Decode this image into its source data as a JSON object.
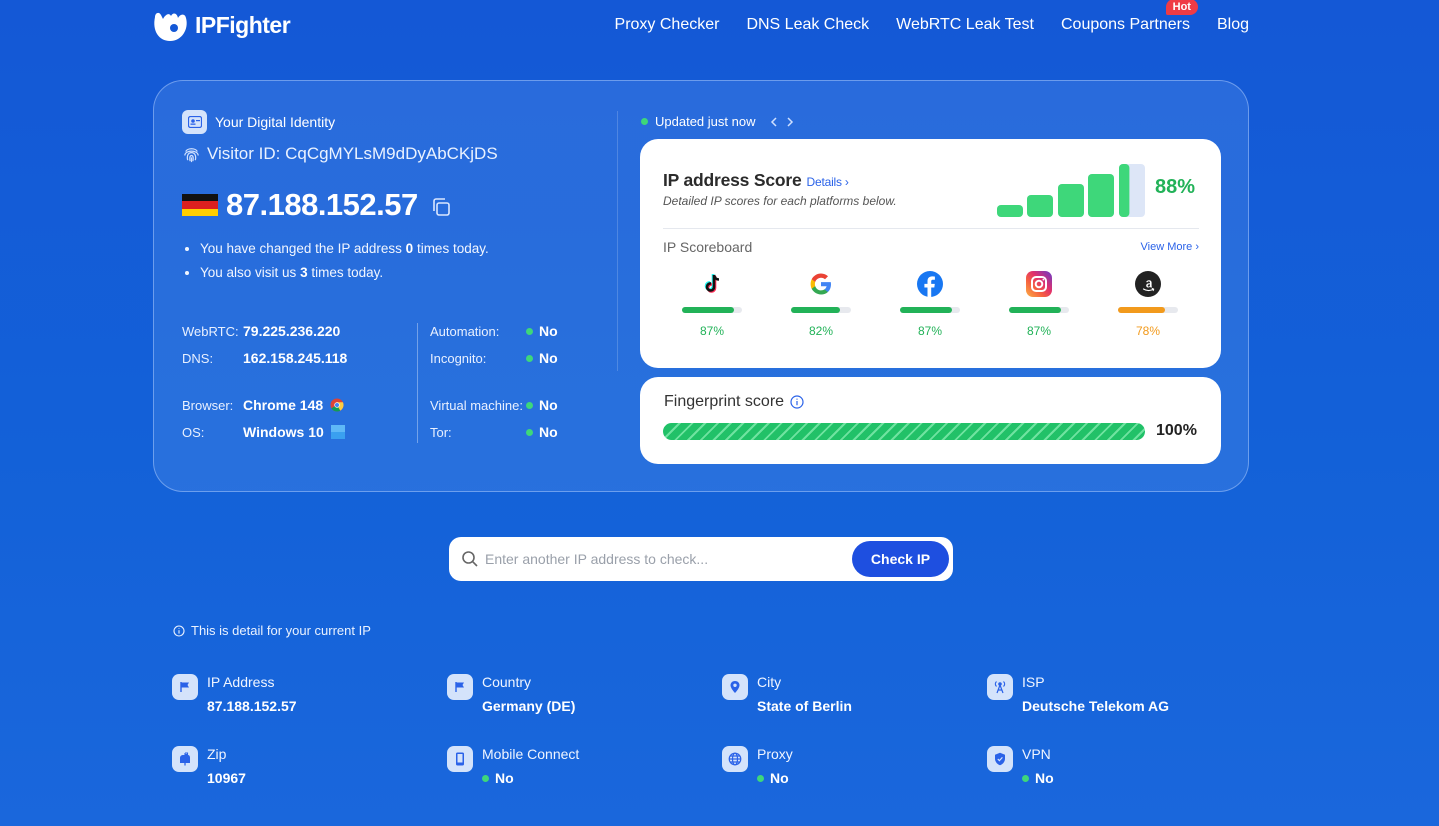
{
  "header": {
    "logo_text": "IPFighter",
    "nav": [
      {
        "label": "Proxy Checker"
      },
      {
        "label": "DNS Leak Check"
      },
      {
        "label": "WebRTC Leak Test"
      },
      {
        "label": "Coupons Partners",
        "badge": "Hot"
      },
      {
        "label": "Blog"
      }
    ]
  },
  "identity": {
    "title": "Your Digital Identity",
    "visitor_id": "Visitor ID: CqCgMYLsM9dDyAbCKjDS",
    "ip": "87.188.152.57",
    "bullets": {
      "b1_pre": "You have changed the IP address ",
      "b1_num": "0",
      "b1_post": " times today.",
      "b2_pre": "You also visit us ",
      "b2_num": "3",
      "b2_post": " times today."
    },
    "webrtc_label": "WebRTC:",
    "webrtc_value": "79.225.236.220",
    "dns_label": "DNS:",
    "dns_value": "162.158.245.118",
    "browser_label": "Browser:",
    "browser_value": "Chrome 148",
    "os_label": "OS:",
    "os_value": "Windows 10",
    "automation_label": "Automation:",
    "automation_value": "No",
    "incognito_label": "Incognito:",
    "incognito_value": "No",
    "vm_label": "Virtual machine:",
    "vm_value": "No",
    "tor_label": "Tor:",
    "tor_value": "No"
  },
  "score": {
    "updated": "Updated just now",
    "title": "IP address Score",
    "details_link": "Details ›",
    "subtitle": "Detailed IP scores for each platforms below.",
    "percent": "88%",
    "percent_value": 88,
    "scoreboard_title": "IP Scoreboard",
    "view_more": "View More ›",
    "platforms": [
      {
        "name": "tiktok-icon",
        "pct": "87%",
        "value": 87,
        "color": "#22b258"
      },
      {
        "name": "google-icon",
        "pct": "82%",
        "value": 82,
        "color": "#22b258"
      },
      {
        "name": "facebook-icon",
        "pct": "87%",
        "value": 87,
        "color": "#22b258"
      },
      {
        "name": "instagram-icon",
        "pct": "87%",
        "value": 87,
        "color": "#22b258"
      },
      {
        "name": "amazon-icon",
        "pct": "78%",
        "value": 78,
        "color": "#f29a1c"
      }
    ]
  },
  "fingerprint": {
    "title": "Fingerprint score",
    "percent": "100%",
    "value": 100
  },
  "search": {
    "placeholder": "Enter another IP address to check...",
    "button": "Check IP"
  },
  "details": {
    "note": "This is detail for your current IP",
    "items": [
      {
        "label": "IP Address",
        "value": "87.188.152.57",
        "icon": "flag-icon"
      },
      {
        "label": "Country",
        "value": "Germany (DE)",
        "icon": "flag-icon"
      },
      {
        "label": "City",
        "value": "State of Berlin",
        "icon": "location-pin-icon"
      },
      {
        "label": "ISP",
        "value": "Deutsche Telekom AG",
        "icon": "antenna-icon"
      },
      {
        "label": "Zip",
        "value": "10967",
        "icon": "mailbox-icon"
      },
      {
        "label": "Mobile Connect",
        "value": "No",
        "icon": "mobile-icon"
      },
      {
        "label": "Proxy",
        "value": "No",
        "icon": "globe-icon"
      },
      {
        "label": "VPN",
        "value": "No",
        "icon": "shield-icon"
      }
    ]
  },
  "colors": {
    "accent_green": "#22b258",
    "accent_orange": "#f29a1c",
    "button_blue": "#1e4fe0"
  }
}
